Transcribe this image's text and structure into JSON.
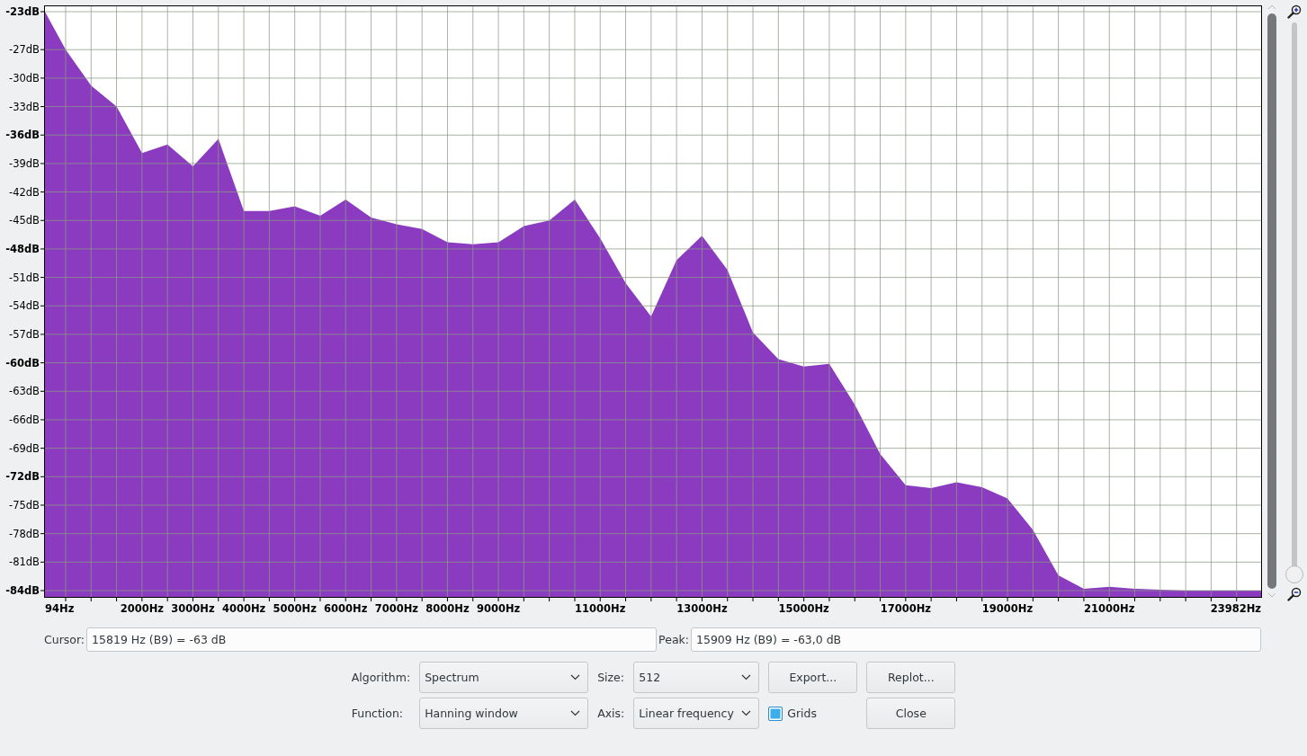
{
  "chart": {
    "chart_data": {
      "type": "area",
      "grid": true,
      "xlim": [
        94,
        23982
      ],
      "ylim": [
        -84,
        -23
      ],
      "x": [
        94,
        500,
        1000,
        1500,
        2000,
        2500,
        3000,
        3500,
        4000,
        4500,
        5000,
        5500,
        6000,
        6500,
        7000,
        7500,
        8000,
        8500,
        9000,
        9500,
        10000,
        10500,
        11000,
        11500,
        12000,
        12500,
        13000,
        13500,
        14000,
        14500,
        15000,
        15500,
        16000,
        16500,
        17000,
        17500,
        18000,
        18500,
        19000,
        19500,
        20000,
        20500,
        21000,
        21500,
        22000,
        22500,
        23000,
        23500,
        23982
      ],
      "series": [
        {
          "color": "#8a3bbf",
          "values": [
            -23,
            -27,
            -30.8,
            -33,
            -37.9,
            -37,
            -39.3,
            -36.4,
            -44,
            -44,
            -43.5,
            -44.5,
            -42.8,
            -44.7,
            -45.4,
            -45.9,
            -47.3,
            -47.5,
            -47.3,
            -45.6,
            -45,
            -42.8,
            -46.9,
            -51.6,
            -55.1,
            -49.2,
            -46.6,
            -50.2,
            -56.8,
            -59.6,
            -60.4,
            -60.1,
            -64.4,
            -69.6,
            -72.9,
            -73.2,
            -72.6,
            -73.1,
            -74.3,
            -77.6,
            -82.4,
            -83.8,
            -83.6,
            -83.8,
            -83.9,
            -84,
            -84,
            -84,
            -84
          ]
        }
      ],
      "xticks": [
        {
          "value": 94,
          "label": "94Hz"
        },
        {
          "value": 2000,
          "label": "2000Hz"
        },
        {
          "value": 3000,
          "label": "3000Hz"
        },
        {
          "value": 4000,
          "label": "4000Hz"
        },
        {
          "value": 5000,
          "label": "5000Hz"
        },
        {
          "value": 6000,
          "label": "6000Hz"
        },
        {
          "value": 7000,
          "label": "7000Hz"
        },
        {
          "value": 8000,
          "label": "8000Hz"
        },
        {
          "value": 9000,
          "label": "9000Hz"
        },
        {
          "value": 11000,
          "label": "11000Hz"
        },
        {
          "value": 13000,
          "label": "13000Hz"
        },
        {
          "value": 15000,
          "label": "15000Hz"
        },
        {
          "value": 17000,
          "label": "17000Hz"
        },
        {
          "value": 19000,
          "label": "19000Hz"
        },
        {
          "value": 21000,
          "label": "21000Hz"
        },
        {
          "value": 23982,
          "label": "23982Hz"
        }
      ],
      "yticks": [
        {
          "value": -23,
          "label": "-23dB"
        },
        {
          "value": -27,
          "label": "-27dB"
        },
        {
          "value": -30,
          "label": "-30dB"
        },
        {
          "value": -33,
          "label": "-33dB"
        },
        {
          "value": -36,
          "label": "-36dB"
        },
        {
          "value": -39,
          "label": "-39dB"
        },
        {
          "value": -42,
          "label": "-42dB"
        },
        {
          "value": -45,
          "label": "-45dB"
        },
        {
          "value": -48,
          "label": "-48dB"
        },
        {
          "value": -51,
          "label": "-51dB"
        },
        {
          "value": -54,
          "label": "-54dB"
        },
        {
          "value": -57,
          "label": "-57dB"
        },
        {
          "value": -60,
          "label": "-60dB"
        },
        {
          "value": -63,
          "label": "-63dB"
        },
        {
          "value": -66,
          "label": "-66dB"
        },
        {
          "value": -69,
          "label": "-69dB"
        },
        {
          "value": -72,
          "label": "-72dB"
        },
        {
          "value": -75,
          "label": "-75dB"
        },
        {
          "value": -78,
          "label": "-78dB"
        },
        {
          "value": -81,
          "label": "-81dB"
        },
        {
          "value": -84,
          "label": "-84dB"
        }
      ]
    }
  },
  "zoom_slider": {
    "level": 0
  },
  "cursor": {
    "label": "Cursor:",
    "value": "15819 Hz (B9) = -63 dB"
  },
  "peak": {
    "label": "Peak:",
    "value": "15909 Hz (B9) = -63,0 dB"
  },
  "algorithm": {
    "label": "Algorithm:",
    "value": "Spectrum"
  },
  "size": {
    "label": "Size:",
    "value": "512"
  },
  "function": {
    "label": "Function:",
    "value": "Hanning window"
  },
  "axis": {
    "label": "Axis:",
    "value": "Linear frequency"
  },
  "grids": {
    "label": "Grids",
    "checked": true
  },
  "buttons": {
    "export": "Export...",
    "replot": "Replot...",
    "close": "Close"
  }
}
